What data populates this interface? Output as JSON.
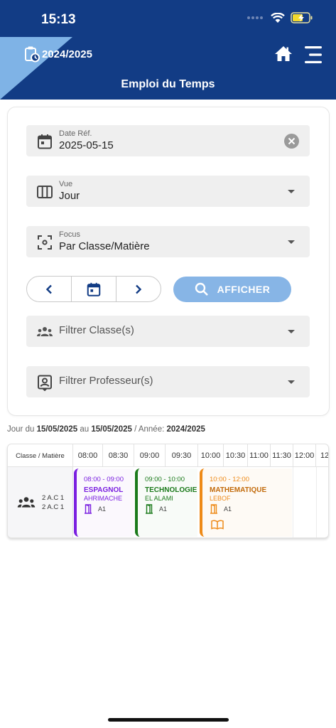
{
  "status_bar": {
    "time": "15:13"
  },
  "header": {
    "year": "2024/2025",
    "title": "Emploi du Temps"
  },
  "form": {
    "date_field": {
      "label": "Date Réf.",
      "value": "2025-05-15"
    },
    "view_field": {
      "label": "Vue",
      "value": "Jour"
    },
    "focus_field": {
      "label": "Focus",
      "value": "Par Classe/Matière"
    },
    "search_label": "AFFICHER",
    "class_filter_placeholder": "Filtrer Classe(s)",
    "teacher_filter_placeholder": "Filtrer Professeur(s)"
  },
  "range": {
    "prefix": "Jour du",
    "from": "15/05/2025",
    "to_word": "au",
    "to": "15/05/2025",
    "year_prefix": "/ Année:",
    "year": "2024/2025"
  },
  "timetable": {
    "first_header": "Classe / Matière",
    "times": [
      "08:00",
      "08:30",
      "09:00",
      "09:30",
      "10:00",
      "10:30",
      "11:00",
      "11:30",
      "12:00",
      "12:"
    ],
    "row": {
      "class_lines": [
        "2 A.C 1",
        "2 A.C 1"
      ]
    },
    "events": [
      {
        "time": "08:00 - 09:00",
        "subject": "ESPAGNOL",
        "teacher": "AHRIMACHE",
        "room": "A1",
        "color": "#7a1fe0"
      },
      {
        "time": "09:00 - 10:00",
        "subject": "TECHNOLOGIE",
        "teacher": "EL ALAMI",
        "room": "A1",
        "color": "#1b7a1b"
      },
      {
        "time": "10:00 - 12:00",
        "subject": "MATHEMATIQUE",
        "teacher": "LEBOF",
        "room": "A1",
        "color": "#ee8a18"
      }
    ]
  },
  "colors": {
    "header": "#123c85",
    "accent_light": "#7fb3e6",
    "search_button": "#87b5e6"
  }
}
